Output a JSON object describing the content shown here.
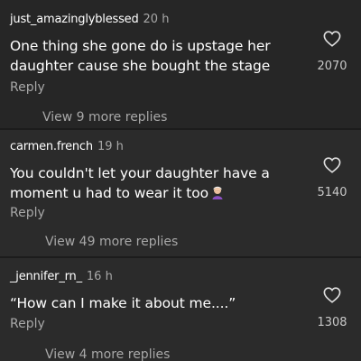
{
  "comments": [
    {
      "username": "just_amazinglyblessed",
      "time": "20 h",
      "text_lines": [
        "One thing she gone do is upstage her",
        "daughter cause she bought the stage"
      ],
      "reply_label": "Reply",
      "like_count": "2070",
      "view_more_label": "View 9 more replies"
    },
    {
      "username": "carmen.french",
      "time": "19 h",
      "text_lines": [
        "You couldn't let your daughter have  a",
        "moment u had to wear it too"
      ],
      "emoji": "woman-facepalming-emoji",
      "reply_label": "Reply",
      "like_count": "5140",
      "view_more_label": "View 49 more replies"
    },
    {
      "username": "_jennifer_rn_",
      "time": "16 h",
      "text_lines": [
        "“How can I make it about me....”"
      ],
      "reply_label": "Reply",
      "like_count": "1308",
      "view_more_label": "View 4 more replies"
    }
  ],
  "icons": {
    "like": "heart-outline-icon"
  },
  "colors": {
    "background": "#262626",
    "text": "#ffffff",
    "secondary_text": "#a8a8a8"
  }
}
